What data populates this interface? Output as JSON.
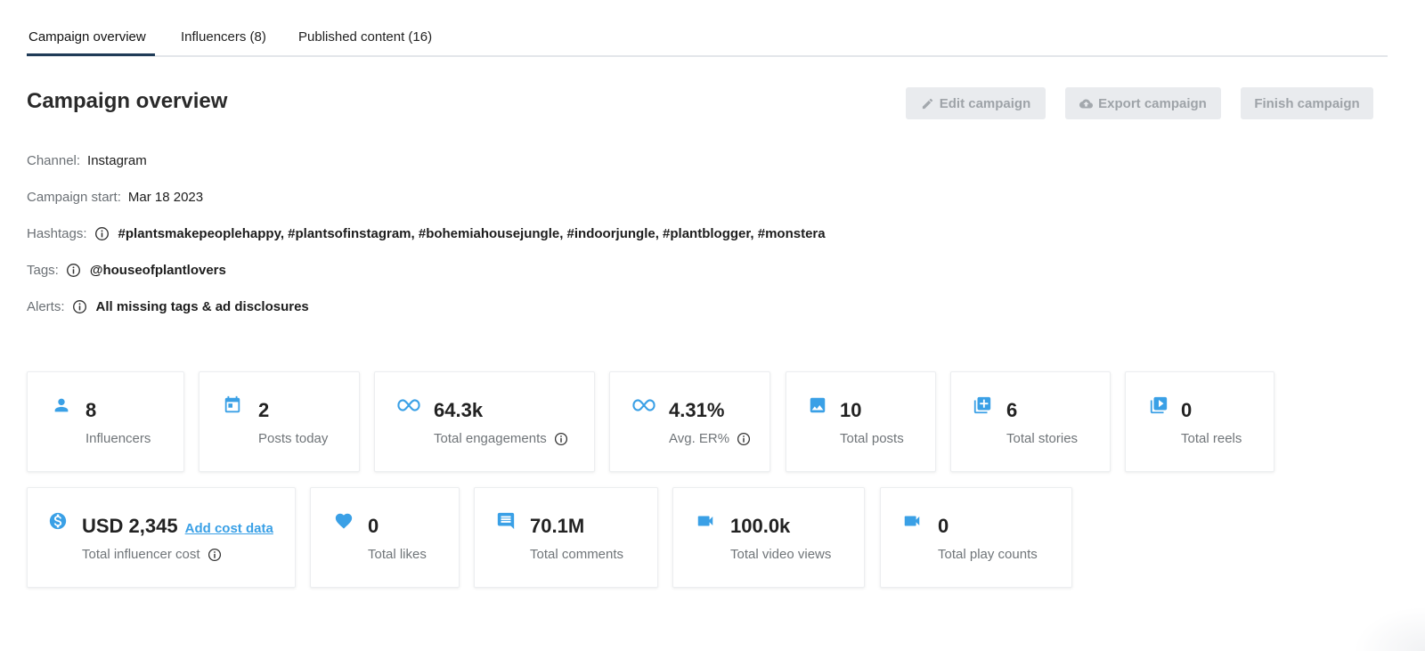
{
  "tabs": [
    {
      "label": "Campaign overview"
    },
    {
      "label": "Influencers (8)"
    },
    {
      "label": "Published content (16)"
    }
  ],
  "header": {
    "title": "Campaign overview",
    "edit_label": "Edit campaign",
    "export_label": "Export campaign",
    "finish_label": "Finish campaign"
  },
  "details": {
    "channel_label": "Channel:",
    "channel_value": "Instagram",
    "start_label": "Campaign start:",
    "start_value": "Mar 18 2023",
    "hashtags_label": "Hashtags:",
    "hashtags_value": "#plantsmakepeoplehappy, #plantsofinstagram, #bohemiahousejungle, #indoorjungle, #plantblogger, #monstera",
    "tags_label": "Tags:",
    "tags_value": "@houseofplantlovers",
    "alerts_label": "Alerts:",
    "alerts_value": "All missing tags & ad disclosures"
  },
  "stats_row1": [
    {
      "icon": "person-icon",
      "value": "8",
      "label": "Influencers"
    },
    {
      "icon": "calendar-icon",
      "value": "2",
      "label": "Posts today"
    },
    {
      "icon": "infinity-icon",
      "value": "64.3k",
      "label": "Total engagements"
    },
    {
      "icon": "infinity-icon",
      "value": "4.31%",
      "label": "Avg. ER%"
    },
    {
      "icon": "image-icon",
      "value": "10",
      "label": "Total posts"
    },
    {
      "icon": "add-story-icon",
      "value": "6",
      "label": "Total stories"
    },
    {
      "icon": "reel-icon",
      "value": "0",
      "label": "Total reels"
    }
  ],
  "stats_row2": [
    {
      "icon": "dollar-icon",
      "value": "USD 2,345",
      "label": "Total influencer cost",
      "link": "Add cost data"
    },
    {
      "icon": "heart-icon",
      "value": "0",
      "label": "Total likes"
    },
    {
      "icon": "comment-icon",
      "value": "70.1M",
      "label": "Total comments"
    },
    {
      "icon": "video-camera-icon",
      "value": "100.0k",
      "label": "Total video views"
    },
    {
      "icon": "video-camera-icon",
      "value": "0",
      "label": "Total play counts"
    }
  ],
  "colors": {
    "accent": "#3aa0e6",
    "tab_underline": "#1f3b57",
    "button_bg": "#e9ebee",
    "button_text": "#9ea3a8"
  }
}
